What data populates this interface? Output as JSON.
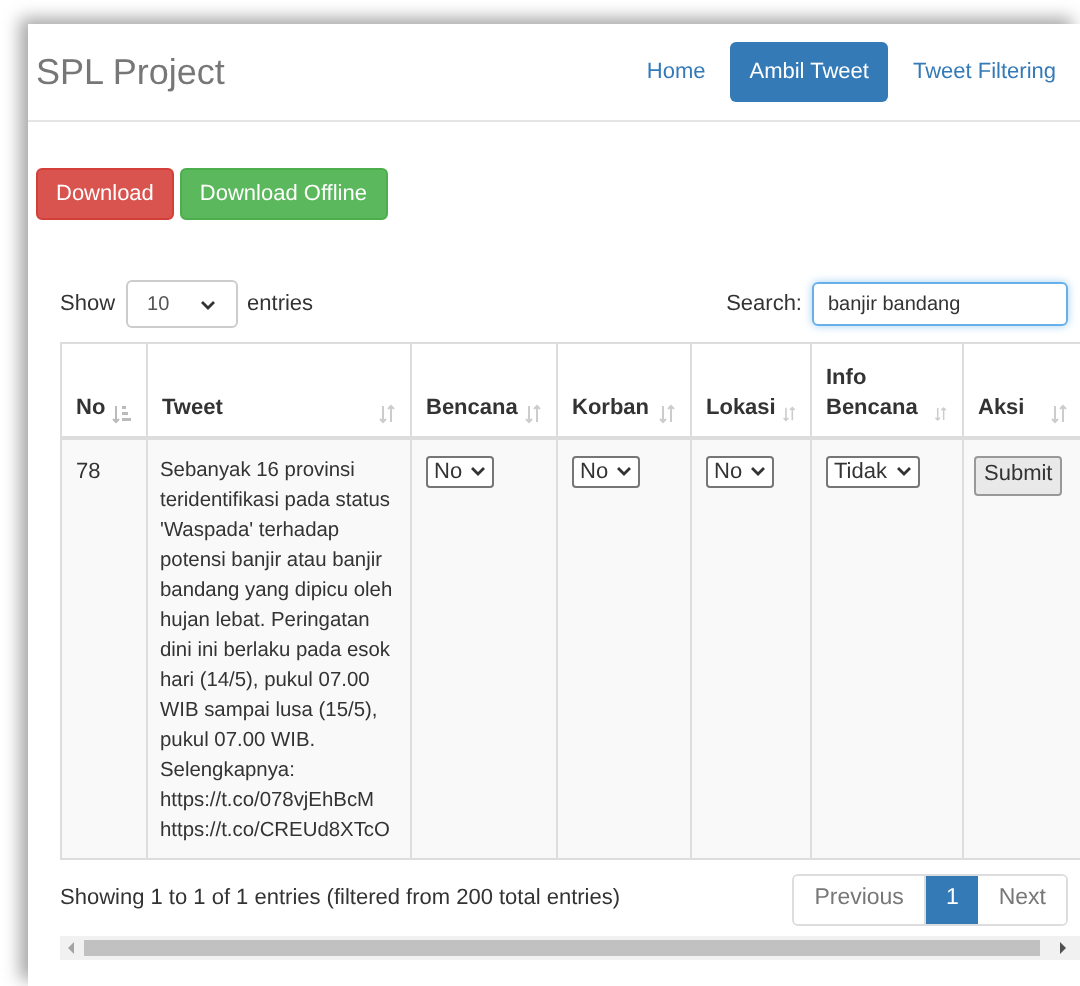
{
  "brand": "SPL Project",
  "nav": [
    {
      "label": "Home",
      "selected": false
    },
    {
      "label": "Ambil Tweet",
      "selected": true
    },
    {
      "label": "Tweet Filtering",
      "selected": false
    }
  ],
  "actions": [
    {
      "label": "Download",
      "kind": "danger"
    },
    {
      "label": "Download Offline",
      "kind": "success"
    }
  ],
  "length": {
    "before": "Show",
    "value": "10",
    "after": "entries"
  },
  "search": {
    "label": "Search:",
    "value": "banjir bandang"
  },
  "table": {
    "columns": [
      {
        "label": "No",
        "sorted": true
      },
      {
        "label": "Tweet",
        "sorted": false
      },
      {
        "label": "Bencana",
        "sorted": false
      },
      {
        "label": "Korban",
        "sorted": false
      },
      {
        "label": "Lokasi",
        "sorted": false
      },
      {
        "label": "Info Bencana",
        "sorted": false
      },
      {
        "label": "Aksi",
        "sorted": false
      }
    ],
    "rows": [
      {
        "no": "78",
        "tweet": "Sebanyak 16 provinsi teridentifikasi pada status 'Waspada' terhadap potensi banjir atau banjir bandang yang dipicu oleh hujan lebat. Peringatan dini ini berlaku pada esok hari (14/5), pukul 07.00 WIB sampai lusa (15/5), pukul 07.00 WIB. Selengkapnya: https://t.co/078vjEhBcM https://t.co/CREUd8XTcO",
        "bencana": "No",
        "korban": "No",
        "lokasi": "No",
        "info_bencana": "Tidak",
        "action": "Submit"
      }
    ]
  },
  "info": "Showing 1 to 1 of 1 entries (filtered from 200 total entries)",
  "pagination": [
    {
      "label": "Previous",
      "selected": false
    },
    {
      "label": "1",
      "selected": true
    },
    {
      "label": "Next",
      "selected": false
    }
  ]
}
